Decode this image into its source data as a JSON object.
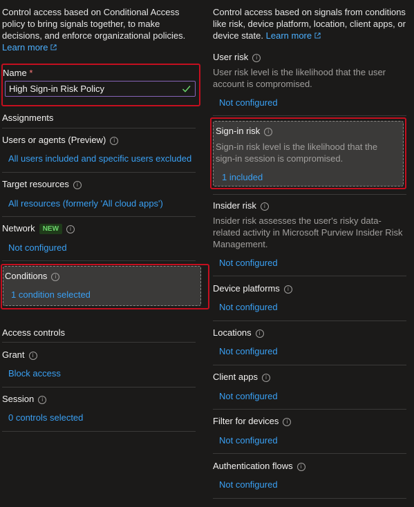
{
  "left": {
    "intro": {
      "line1": "Control access based on Conditional Access",
      "line2": "policy to bring signals together, to make",
      "line3": "decisions, and enforce organizational policies.",
      "learn_more": "Learn more"
    },
    "name": {
      "label": "Name",
      "required_mark": "*",
      "value": "High Sign-in Risk Policy"
    },
    "assignments_header": "Assignments",
    "users": {
      "label": "Users or agents (Preview)",
      "value": "All users included and specific users excluded"
    },
    "target": {
      "label": "Target resources",
      "value": "All resources (formerly 'All cloud apps')"
    },
    "network": {
      "label": "Network",
      "badge": "NEW",
      "value": "Not configured"
    },
    "conditions": {
      "label": "Conditions",
      "value": "1 condition selected"
    },
    "access_controls_header": "Access controls",
    "grant": {
      "label": "Grant",
      "value": "Block access"
    },
    "session": {
      "label": "Session",
      "value": "0 controls selected"
    }
  },
  "right": {
    "intro": {
      "line1": "Control access based on signals from conditions",
      "line2": "like risk, device platform, location, client apps, or",
      "line3_prefix": "device state.",
      "learn_more": "Learn more"
    },
    "user_risk": {
      "label": "User risk",
      "desc1": "User risk level is the likelihood that the user",
      "desc2": "account is compromised.",
      "value": "Not configured"
    },
    "signin_risk": {
      "label": "Sign-in risk",
      "desc1": "Sign-in risk level is the likelihood that the",
      "desc2": "sign-in session is compromised.",
      "value": "1 included"
    },
    "insider_risk": {
      "label": "Insider risk",
      "desc1": "Insider risk assesses the user's risky data-",
      "desc2": "related activity in Microsoft Purview Insider Risk",
      "desc3": "Management.",
      "value": "Not configured"
    },
    "device_platforms": {
      "label": "Device platforms",
      "value": "Not configured"
    },
    "locations": {
      "label": "Locations",
      "value": "Not configured"
    },
    "client_apps": {
      "label": "Client apps",
      "value": "Not configured"
    },
    "filter_devices": {
      "label": "Filter for devices",
      "value": "Not configured"
    },
    "auth_flows": {
      "label": "Authentication flows",
      "value": "Not configured"
    }
  },
  "colors": {
    "accent": "#3aa0f3",
    "highlight_border": "#c50f1f",
    "input_border": "#8764b8",
    "success": "#6bd66b"
  },
  "icons": [
    "info-icon",
    "external-link-icon",
    "checkmark-icon"
  ]
}
